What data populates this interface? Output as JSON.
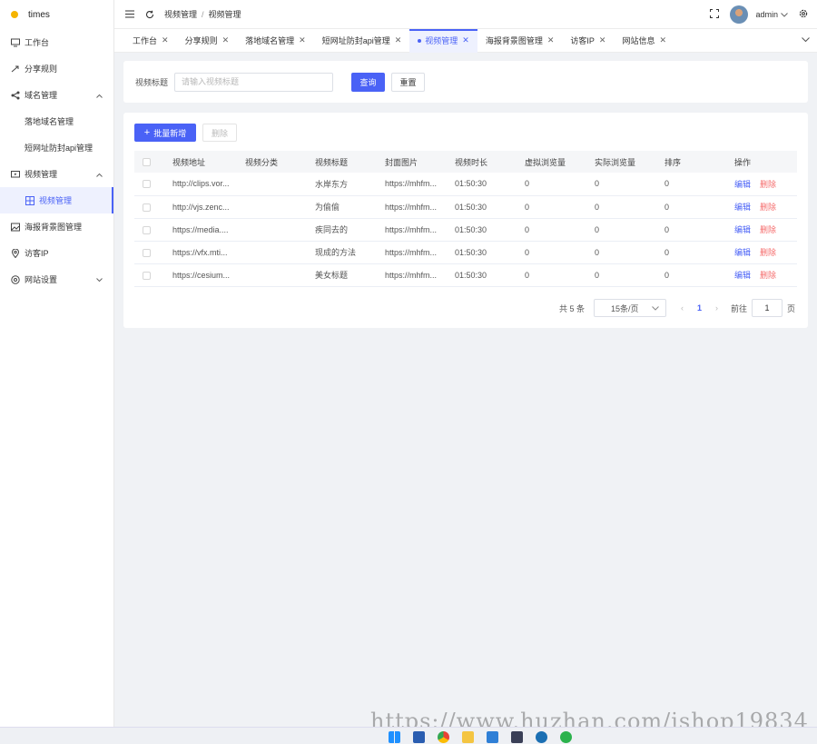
{
  "app": {
    "name": "times"
  },
  "sidebar": {
    "items": [
      {
        "label": "工作台",
        "icon": "monitor-icon"
      },
      {
        "label": "分享规则",
        "icon": "share-icon"
      },
      {
        "label": "域名管理",
        "icon": "network-icon",
        "expanded": true
      },
      {
        "label": "落地域名管理"
      },
      {
        "label": "短网址防封api管理"
      },
      {
        "label": "视频管理",
        "icon": "video-icon",
        "expanded": true
      },
      {
        "label": "视频管理",
        "icon": "grid-icon",
        "active": true
      },
      {
        "label": "海报背景图管理",
        "icon": "image-icon"
      },
      {
        "label": "访客IP",
        "icon": "location-icon"
      },
      {
        "label": "网站设置",
        "icon": "settings-icon",
        "expanded": false
      }
    ]
  },
  "header": {
    "breadcrumb": [
      "视频管理",
      "视频管理"
    ],
    "user": "admin"
  },
  "tabs": [
    {
      "label": "工作台"
    },
    {
      "label": "分享规则"
    },
    {
      "label": "落地域名管理"
    },
    {
      "label": "短网址防封api管理"
    },
    {
      "label": "视频管理",
      "active": true
    },
    {
      "label": "海报背景图管理"
    },
    {
      "label": "访客IP"
    },
    {
      "label": "网站信息"
    }
  ],
  "search": {
    "label": "视频标题",
    "placeholder": "请输入视频标题",
    "query_label": "查询",
    "reset_label": "重置"
  },
  "toolbar": {
    "add_label": "批量新增",
    "delete_label": "删除"
  },
  "table": {
    "columns": [
      "视频地址",
      "视频分类",
      "视频标题",
      "封面图片",
      "视频时长",
      "虚拟浏览量",
      "实际浏览量",
      "排序",
      "操作"
    ],
    "rows": [
      {
        "url": "http://clips.vor...",
        "category": "",
        "title": "水岸东方",
        "cover": "https://mhfm...",
        "duration": "01:50:30",
        "virtual_views": "0",
        "real_views": "0",
        "sort": "0"
      },
      {
        "url": "http://vjs.zenc...",
        "category": "",
        "title": "为偷偷",
        "cover": "https://mhfm...",
        "duration": "01:50:30",
        "virtual_views": "0",
        "real_views": "0",
        "sort": "0"
      },
      {
        "url": "https://media....",
        "category": "",
        "title": "疾同去的",
        "cover": "https://mhfm...",
        "duration": "01:50:30",
        "virtual_views": "0",
        "real_views": "0",
        "sort": "0"
      },
      {
        "url": "https://vfx.mti...",
        "category": "",
        "title": "现成的方法",
        "cover": "https://mhfm...",
        "duration": "01:50:30",
        "virtual_views": "0",
        "real_views": "0",
        "sort": "0"
      },
      {
        "url": "https://cesium...",
        "category": "",
        "title": "美女标题",
        "cover": "https://mhfm...",
        "duration": "01:50:30",
        "virtual_views": "0",
        "real_views": "0",
        "sort": "0"
      }
    ],
    "edit_label": "编辑",
    "delete_label": "删除"
  },
  "pagination": {
    "total_text": "共 5 条",
    "page_size": "15条/页",
    "current_page": "1",
    "goto_label": "前往",
    "goto_value": "1",
    "page_unit": "页"
  },
  "watermark": "https://www.huzhan.com/ishop19834",
  "colors": {
    "primary": "#4a62f6",
    "danger": "#f56c6c",
    "background": "#f0f2f5"
  }
}
